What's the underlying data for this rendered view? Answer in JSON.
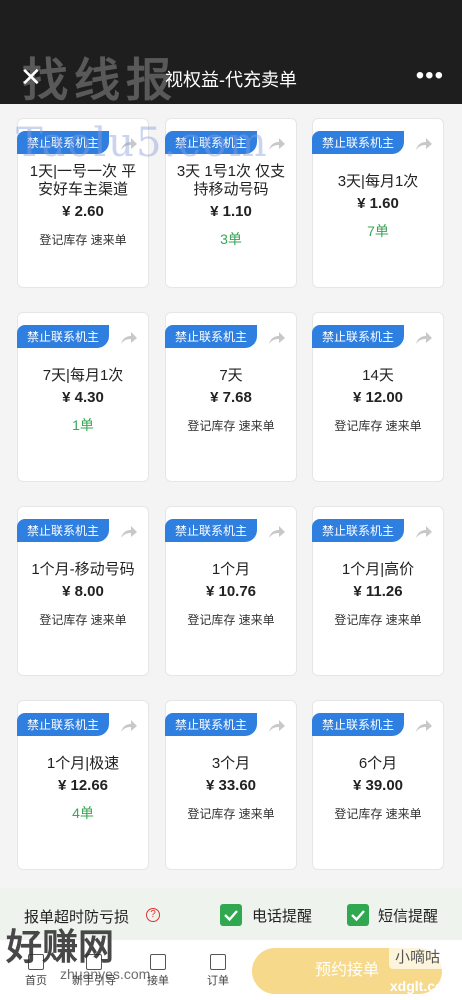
{
  "header": {
    "title": "视权益-代充卖单",
    "close_icon": "close-icon",
    "more_icon": "more-icon"
  },
  "watermarks": {
    "top": "找线报",
    "blue": "Taolu5.com",
    "left": "好赚网",
    "left_url": "zhuanyes.com",
    "right": "小嘀咕",
    "right_url": "xdglt.com"
  },
  "badge_label": "禁止联系机主",
  "cards": [
    {
      "name": "1天|一号一次 平安好车主渠道",
      "price": "¥ 2.60",
      "sub": "登记库存 速来单",
      "count": ""
    },
    {
      "name": "3天 1号1次 仅支持移动号码",
      "price": "¥ 1.10",
      "sub": "",
      "count": "3单"
    },
    {
      "name": "3天|每月1次",
      "price": "¥ 1.60",
      "sub": "",
      "count": "7单"
    },
    {
      "name": "7天|每月1次",
      "price": "¥ 4.30",
      "sub": "",
      "count": "1单"
    },
    {
      "name": "7天",
      "price": "¥ 7.68",
      "sub": "登记库存 速来单",
      "count": ""
    },
    {
      "name": "14天",
      "price": "¥ 12.00",
      "sub": "登记库存 速来单",
      "count": ""
    },
    {
      "name": "1个月-移动号码",
      "price": "¥ 8.00",
      "sub": "登记库存 速来单",
      "count": ""
    },
    {
      "name": "1个月",
      "price": "¥ 10.76",
      "sub": "登记库存 速来单",
      "count": ""
    },
    {
      "name": "1个月|高价",
      "price": "¥ 11.26",
      "sub": "登记库存 速来单",
      "count": ""
    },
    {
      "name": "1个月|极速",
      "price": "¥ 12.66",
      "sub": "",
      "count": "4单"
    },
    {
      "name": "3个月",
      "price": "¥ 33.60",
      "sub": "登记库存 速来单",
      "count": ""
    },
    {
      "name": "6个月",
      "price": "¥ 39.00",
      "sub": "登记库存 速来单",
      "count": ""
    }
  ],
  "bottom": {
    "timeout_label": "报单超时防亏损",
    "phone_remind": "电话提醒",
    "sms_remind": "短信提醒",
    "reserve_button": "预约接单"
  },
  "tabs": [
    {
      "label": "首页"
    },
    {
      "label": "新手引导"
    },
    {
      "label": "接单"
    },
    {
      "label": "订单"
    }
  ],
  "colors": {
    "accent": "#2f7fe0",
    "count_green": "#3aa655",
    "checkbox_green": "#2fa84f",
    "reserve_bg": "#f7d98b"
  }
}
